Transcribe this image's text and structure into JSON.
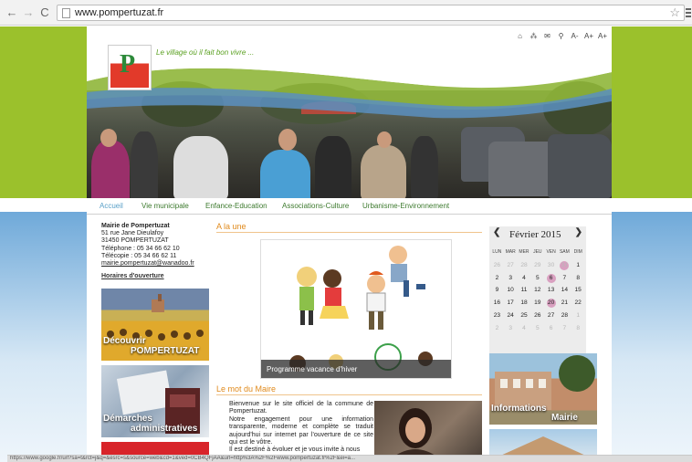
{
  "browser": {
    "url": "www.pompertuzat.fr",
    "status_url": "https://www.google.fr/url?sa=t&rct=j&q=&esrc=s&source=web&cd=1&ved=0CB4QFjAA&url=http%3A%2F%2Fwww.pompertuzat.fr%2F&ei=a..."
  },
  "header": {
    "tagline": "Le village où il fait bon vivre ...",
    "tools": [
      "⌂",
      "⁂",
      "✉",
      "⚲",
      "A-",
      "A+",
      "A+"
    ]
  },
  "nav": {
    "items": [
      "Accueil",
      "Vie municipale",
      "Enfance-Education",
      "Associations-Culture",
      "Urbanisme-Environnement"
    ]
  },
  "contact": {
    "title": "Mairie de Pompertuzat",
    "street": "51 rue Jane Dieulafoy",
    "city": "31450 POMPERTUZAT",
    "phone": "Téléphone : 05 34 66 62 10",
    "fax": "Télécopie :  05 34 66 62 11",
    "email": "mairie.pompertuzat@wanadoo.fr",
    "hours_link": "Horaires d'ouverture"
  },
  "promos": {
    "decouvrir_line1": "Découvrir",
    "decouvrir_line2": "POMPERTUZAT",
    "demarches_line1": "Démarches",
    "demarches_line2": "administratives"
  },
  "une": {
    "title": "A la une",
    "caption": "Programme vacance d'hiver"
  },
  "mot": {
    "title": "Le mot du Maire",
    "text": "Bienvenue sur le site officiel de la commune de Pompertuzat.\nNotre engagement pour une information transparente, moderne et complète se traduit aujourd'hui sur internet par l'ouverture de ce site qui est le vôtre.\nIl est destiné à évoluer et je vous invite à nous"
  },
  "calendar": {
    "month": "Février 2015",
    "prev": "❮",
    "next": "❯",
    "days_of_week": [
      "LUN",
      "MAR",
      "MER",
      "JEU",
      "VEN",
      "SAM",
      "DIM"
    ],
    "weeks": [
      [
        {
          "d": "26",
          "m": true
        },
        {
          "d": "27",
          "m": true
        },
        {
          "d": "28",
          "m": true
        },
        {
          "d": "29",
          "m": true
        },
        {
          "d": "30",
          "m": true
        },
        {
          "d": "31",
          "m": true,
          "h": true
        },
        {
          "d": "1"
        }
      ],
      [
        {
          "d": "2"
        },
        {
          "d": "3"
        },
        {
          "d": "4"
        },
        {
          "d": "5"
        },
        {
          "d": "6",
          "h": true
        },
        {
          "d": "7"
        },
        {
          "d": "8"
        }
      ],
      [
        {
          "d": "9"
        },
        {
          "d": "10"
        },
        {
          "d": "11"
        },
        {
          "d": "12"
        },
        {
          "d": "13"
        },
        {
          "d": "14"
        },
        {
          "d": "15"
        }
      ],
      [
        {
          "d": "16"
        },
        {
          "d": "17"
        },
        {
          "d": "18"
        },
        {
          "d": "19"
        },
        {
          "d": "20",
          "h": true
        },
        {
          "d": "21"
        },
        {
          "d": "22"
        }
      ],
      [
        {
          "d": "23"
        },
        {
          "d": "24"
        },
        {
          "d": "25"
        },
        {
          "d": "26"
        },
        {
          "d": "27"
        },
        {
          "d": "28"
        },
        {
          "d": "1",
          "m": true
        }
      ],
      [
        {
          "d": "2",
          "m": true
        },
        {
          "d": "3",
          "m": true
        },
        {
          "d": "4",
          "m": true
        },
        {
          "d": "5",
          "m": true
        },
        {
          "d": "6",
          "m": true
        },
        {
          "d": "7",
          "m": true
        },
        {
          "d": "8",
          "m": true
        }
      ]
    ]
  },
  "right": {
    "info_line1": "Informations",
    "info_line2": "Mairie"
  },
  "colors": {
    "green": "#9bc12c",
    "orange": "#e08a1c",
    "nav_green": "#3d7a2e",
    "nav_active": "#5aa0c8"
  }
}
